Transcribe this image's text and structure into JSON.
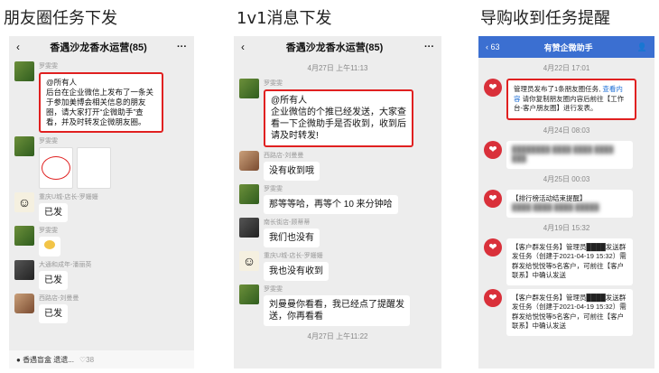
{
  "titles": [
    "朋友圈任务下发",
    "1v1消息下发",
    "导购收到任务提醒"
  ],
  "p1": {
    "back": "‹",
    "title": "香遇沙龙香水运营(85)",
    "more": "···",
    "sender": "罗雯雯",
    "msg": "@所有人\n后台在企业微信上发布了一条关于参加美博会相关信息的朋友圈，请大家打开“企微助手”查看，并及时转发企微朋友圈。",
    "sender2": "罗雯雯",
    "n_chongqing": "重庆U城-店长-罗姗姗",
    "m_chongqing": "已发",
    "n_luo": "罗雯雯",
    "n_datong": "大通和成年-潘丽英",
    "m_datong": "已发",
    "n_xilu": "西路店-刘曼曼",
    "m_xilu": "已发",
    "bottom": "香遇盲盒 遗遗...",
    "likes": "38"
  },
  "p2": {
    "back": "‹",
    "title": "香遇沙龙香水运营(85)",
    "more": "···",
    "ts1": "4月27日 上午11:13",
    "sender": "罗雯雯",
    "msg": "@所有人\n企业微信的个推已经发送，大家查看一下企微助手是否收到，收到后请及时转发!",
    "n_xilu": "西路店-刘曼曼",
    "m_xilu": "没有收到哦",
    "n_luo": "罗雯雯",
    "m_luo": "那等等哈，再等个 10 来分钟哈",
    "n_nanchang": "南长街店-顾蒂蒂",
    "m_nanchang": "我们也没有",
    "n_chongqing": "重庆U城-店长-罗姗姗",
    "m_chongqing": "我也没有收到",
    "n_luo2": "罗雯雯",
    "m_luo2": "刘曼曼你看看，我已经点了提醒发送，你再看看",
    "ts2": "4月27日 上午11:22"
  },
  "p3": {
    "back": "‹ 63",
    "title": "有赞企微助手",
    "ts1": "4月22日 17:01",
    "card1": "管理员发布了1条朋友圈任务",
    "card1_link": "查看内容",
    "card1_rest": "请你复制朋友圈内容后前往【工作台-客户朋友圈】进行发表。",
    "ts2": "4月24日 08:03",
    "card2": "████████ ████ ████ ████ ███",
    "ts3": "4月25日 00:03",
    "card3": "【排行榜活动结束提醒】",
    "card3_rest": "████ ████ ████ █████",
    "ts4": "4月19日 15:32",
    "card4": "【客户群发任务】管理员████发送群发任务（创建于2021-04-19 15:32）需群发给悦悦等5名客户，可前往【客户联系】中确认发送",
    "card5": "【客户群发任务】管理员████发送群发任务（创建于2021-04-19 15:32）需群发给悦悦等5名客户，可前往【客户联系】中确认发送",
    "accent": "#3b6fd1",
    "red": "#e02020"
  }
}
